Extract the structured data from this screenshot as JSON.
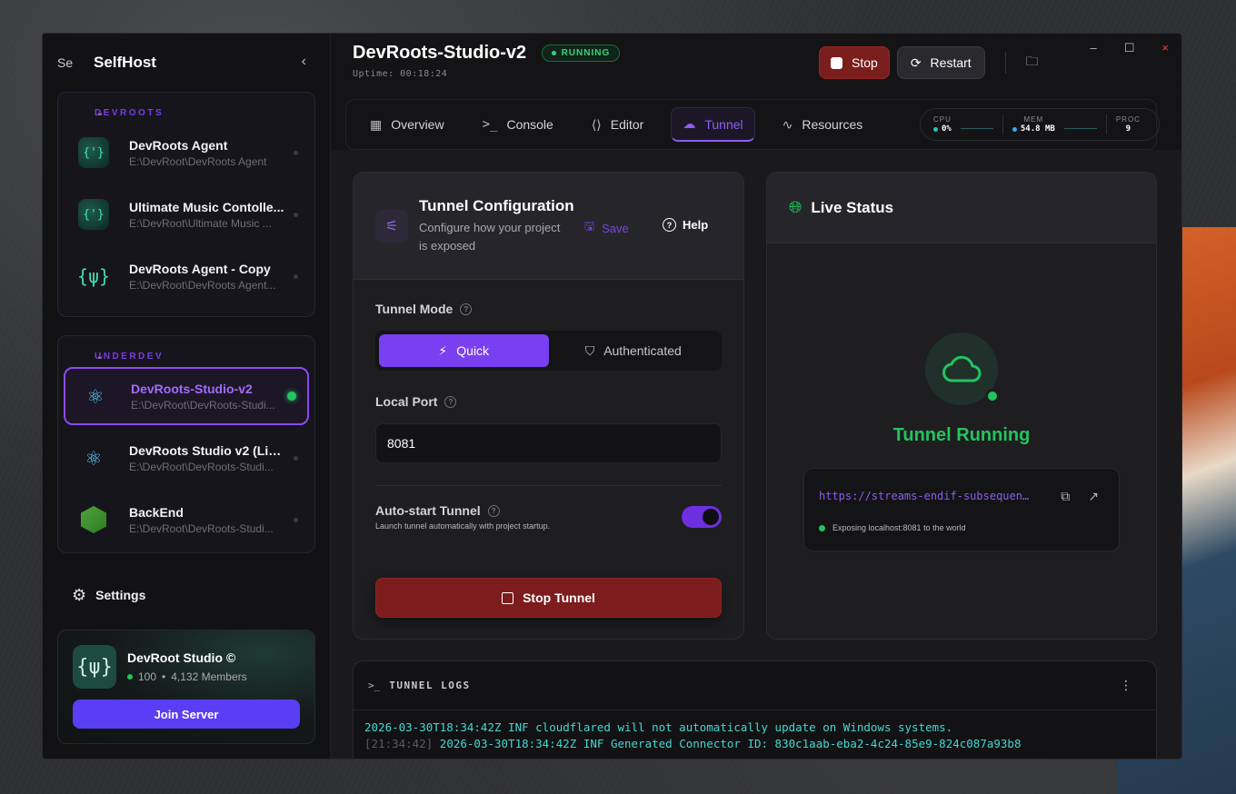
{
  "sidebar": {
    "brand": {
      "logo_alt": "Se",
      "name": "SelfHost"
    },
    "groups": [
      {
        "name": "DEVROOTS",
        "projects": [
          {
            "name": "DevRoots Agent",
            "path": "E:\\DevRoot\\DevRoots Agent",
            "icon": "{'}"
          },
          {
            "name": "Ultimate Music Contolle...",
            "path": "E:\\DevRoot\\Ultimate Music ...",
            "icon": "{'}"
          },
          {
            "name": "DevRoots Agent - Copy",
            "path": "E:\\DevRoot\\DevRoots Agent...",
            "icon": "{ψ}"
          }
        ]
      },
      {
        "name": "UNDERDEV",
        "projects": [
          {
            "name": "DevRoots-Studio-v2",
            "path": "E:\\DevRoot\\DevRoots-Studi...",
            "icon": "⚛"
          },
          {
            "name": "DevRoots Studio v2 (Live)",
            "path": "E:\\DevRoot\\DevRoots-Studi...",
            "icon": "⚛"
          },
          {
            "name": "BackEnd",
            "path": "E:\\DevRoot\\DevRoots-Studi..."
          }
        ]
      }
    ],
    "settings_label": "Settings",
    "server": {
      "name": "DevRoot Studio ©",
      "online": "100",
      "members": "4,132 Members",
      "join_label": "Join Server",
      "logo": "{ψ}"
    }
  },
  "header": {
    "title": "DevRoots-Studio-v2",
    "status": "RUNNING",
    "uptime": "Uptime: 00:18:24",
    "stop_label": "Stop",
    "restart_label": "Restart"
  },
  "tabs": [
    {
      "label": "Overview",
      "icon": "grid-icon"
    },
    {
      "label": "Console",
      "icon": "terminal-icon"
    },
    {
      "label": "Editor",
      "icon": "code-file-icon"
    },
    {
      "label": "Tunnel",
      "icon": "cloud-icon",
      "active": true
    },
    {
      "label": "Resources",
      "icon": "activity-icon"
    }
  ],
  "stats": {
    "cpu_label": "CPU",
    "cpu_value": "0%",
    "mem_label": "MEM",
    "mem_value": "54.8 MB",
    "proc_label": "PROC",
    "proc_value": "9"
  },
  "config": {
    "title": "Tunnel Configuration",
    "subtitle": "Configure how your project is exposed",
    "save_label": "Save",
    "help_label": "Help",
    "mode_label": "Tunnel Mode",
    "mode_options": [
      "Quick",
      "Authenticated"
    ],
    "mode_selected": "Quick",
    "port_label": "Local Port",
    "port_value": "8081",
    "autostart_label": "Auto-start Tunnel",
    "autostart_desc": "Launch tunnel automatically with project startup.",
    "autostart_on": true,
    "stop_tunnel_label": "Stop Tunnel"
  },
  "live": {
    "title": "Live Status",
    "status_text": "Tunnel Running",
    "url": "https://streams-endif-subsequent.trycloudflare.com",
    "expose_text": "Exposing localhost:8081 to the world"
  },
  "logs": {
    "title": "TUNNEL LOGS",
    "prompt": ">_",
    "lines": [
      {
        "ts": "",
        "text": "2026-03-30T18:34:42Z INF cloudflared will not automatically update on Windows systems."
      },
      {
        "ts": "[21:34:42]",
        "text": "2026-03-30T18:34:42Z INF Generated Connector ID: 830c1aab-eba2-4c24-85e9-824c087a93b8"
      }
    ]
  },
  "colors": {
    "accent": "#7a3ff0",
    "success": "#22c55e",
    "danger": "#7d1c1c"
  }
}
